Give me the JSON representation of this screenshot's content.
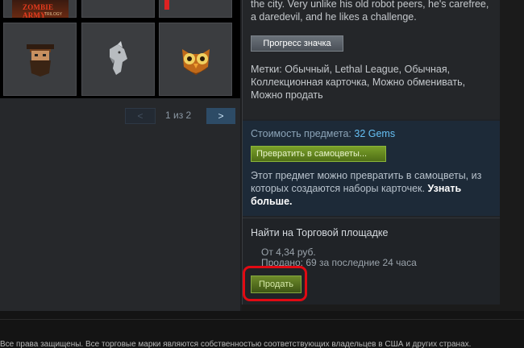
{
  "pagination": {
    "prev_label": "<",
    "page_text": "1 из 2",
    "next_label": ">"
  },
  "inventory": {
    "first_item_title": "ZOMBIE ARMY",
    "first_item_subtitle": "TRILOGY",
    "items": [
      {
        "name": "bearded-man-icon"
      },
      {
        "name": "horse-head-icon"
      },
      {
        "name": "owl-icon"
      }
    ]
  },
  "item_details": {
    "description": "the city. Very unlike his old robot peers, he's carefree, a daredevil, and he likes a challenge.",
    "progress_button": "Прогресс значка",
    "tags": "Метки: Обычный, Lethal League, Обычная, Коллекционная карточка, Можно обменивать, Можно продать"
  },
  "gems": {
    "price_label": "Стоимость предмета:",
    "price_value": "32 Gems",
    "convert_button": "Превратить в самоцветы...",
    "note": "Этот предмет можно превратить в самоцветы, из которых создаются наборы карточек.",
    "learn_more": "Узнать больше."
  },
  "market": {
    "title": "Найти на Торговой площадке",
    "from_price": "От 4,34 руб.",
    "sold": "Продано: 69 за последние 24 часа",
    "sell_button": "Продать"
  },
  "footer": {
    "text": "Все права защищены. Все торговые марки являются собственностью соответствующих владельцев в США и других странах."
  },
  "colors": {
    "highlight": "#e10a13",
    "gems_value": "#66c0f4",
    "sell_button": "#6d8a2a"
  }
}
